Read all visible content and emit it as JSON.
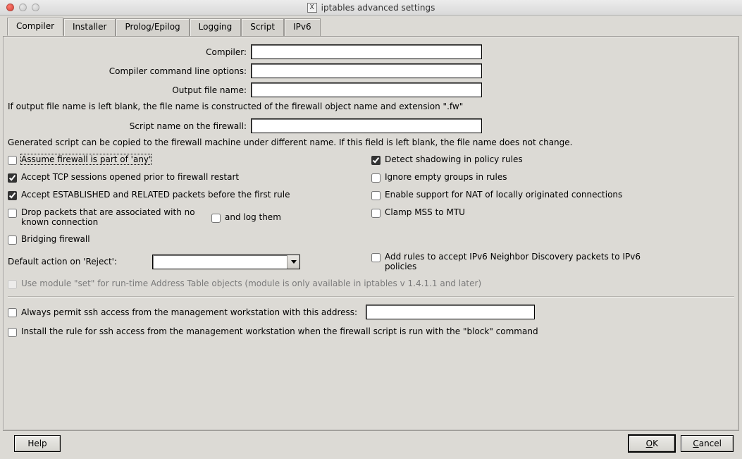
{
  "window": {
    "title": "iptables advanced settings",
    "icon_label": "X"
  },
  "tabs": [
    "Compiler",
    "Installer",
    "Prolog/Epilog",
    "Logging",
    "Script",
    "IPv6"
  ],
  "active_tab": "Compiler",
  "form": {
    "compiler_label": "Compiler:",
    "compiler_value": "",
    "cmdline_label": "Compiler command line options:",
    "cmdline_value": "",
    "output_label": "Output file name:",
    "output_value": "",
    "output_note": "If output file name is left blank, the file name is constructed of the firewall object name and extension \".fw\"",
    "scriptname_label": "Script name on the firewall:",
    "scriptname_value": "",
    "scriptname_note": "Generated script can be copied to the firewall machine under different name. If this field is left blank, the file name does not change."
  },
  "checks": {
    "assume_any": {
      "label": "Assume firewall is part of 'any'",
      "checked": false
    },
    "accept_tcp": {
      "label": "Accept TCP sessions opened prior to firewall restart",
      "checked": true
    },
    "accept_est": {
      "label": "Accept ESTABLISHED and RELATED packets before the first rule",
      "checked": true
    },
    "drop_unknown": {
      "label": "Drop packets that are associated with no known connection",
      "checked": false
    },
    "and_log": {
      "label": "and log them",
      "checked": false
    },
    "bridging": {
      "label": "Bridging firewall",
      "checked": false
    },
    "detect_shadow": {
      "label": "Detect shadowing in policy rules",
      "checked": true
    },
    "ignore_empty": {
      "label": "Ignore empty groups in rules",
      "checked": false
    },
    "nat_local": {
      "label": "Enable support for NAT of locally originated connections",
      "checked": false
    },
    "clamp_mss": {
      "label": "Clamp MSS to MTU",
      "checked": false
    },
    "ipv6_nd": {
      "label": "Add rules to accept IPv6 Neighbor Discovery packets to IPv6 policies",
      "checked": false
    },
    "use_set": {
      "label": "Use module \"set\" for run-time Address Table objects (module is only available in iptables v 1.4.1.1 and later)",
      "checked": false,
      "disabled": true
    }
  },
  "reject": {
    "label": "Default action on 'Reject':",
    "value": ""
  },
  "ssh": {
    "always_permit": {
      "label": "Always permit ssh access from the management workstation with this address:",
      "checked": false,
      "value": ""
    },
    "install_block": {
      "label": "Install the rule for ssh access from the management workstation when the firewall script is run with the \"block\" command",
      "checked": false
    }
  },
  "buttons": {
    "help": "Help",
    "ok_mn": "O",
    "ok_rest": "K",
    "cancel_mn": "C",
    "cancel_rest": "ancel"
  }
}
